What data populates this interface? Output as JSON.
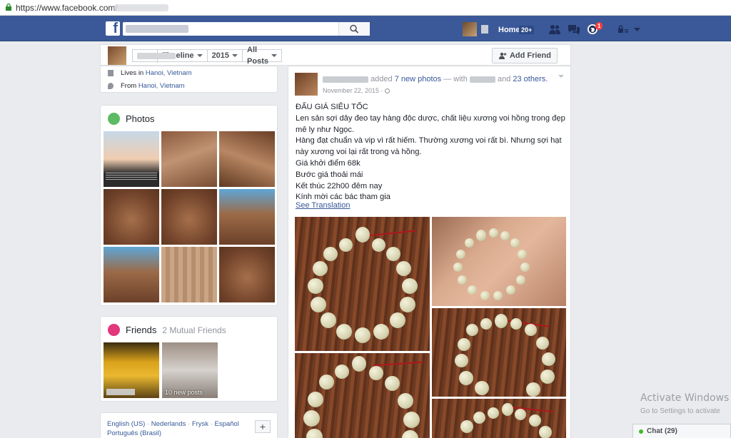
{
  "browser": {
    "url": "https://www.facebook.com/"
  },
  "topbar": {
    "home_label": "Home",
    "home_count": "20+",
    "notification_count": "1"
  },
  "profile_nav": {
    "timeline": "Timeline",
    "year": "2015",
    "posts_filter": "All Posts",
    "add_friend": "Add Friend"
  },
  "about": {
    "lives_prefix": "Lives in",
    "lives_place": "Hanoi, Vietnam",
    "from_prefix": "From",
    "from_place": "Hanoi, Vietnam"
  },
  "photos": {
    "title": "Photos"
  },
  "friends": {
    "title": "Friends",
    "mutual": "2 Mutual Friends",
    "new_posts": "10 new posts"
  },
  "footer_langs": {
    "line1": [
      "English (US)",
      "Nederlands",
      "Frysk",
      "Español"
    ],
    "line2": "Português (Brasil)",
    "plus": "+"
  },
  "post": {
    "added": "added",
    "photo_count_text": "7 new photos",
    "with": "— with",
    "and": "and",
    "others": "23 others.",
    "date": "November 22, 2015 ·",
    "lines": [
      "ĐẤU GIÁ SIÊU TỐC",
      "Len sản sợi dây đeo tay hàng độc dược, chất liệu xương voi hồng trong đẹp",
      "mê ly như Ngọc.",
      "Hàng đạt chuẩn và vip vì rất hiếm. Thường xương voi rất bì. Nhưng sợi hạt",
      "này xương voi lại rất trong và hồng.",
      "Giá khởi điểm 68k",
      "Bước giá thoải mái",
      "Kết thúc 22h00 đêm nay",
      "Kính mời các bác tham gia"
    ],
    "see_translation": "See Translation"
  },
  "windows": {
    "activate_title": "Activate Windows",
    "activate_sub": "Go to Settings to activate"
  },
  "chat": {
    "label": "Chat (29)"
  },
  "colors": {
    "fb_blue": "#3b5998",
    "link": "#365899",
    "badge_red": "#fa3e3e",
    "online_green": "#42b72a"
  }
}
